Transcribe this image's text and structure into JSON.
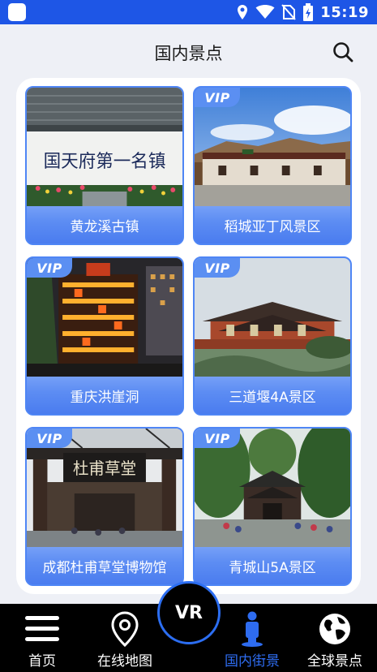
{
  "status_bar": {
    "time": "15:19"
  },
  "header": {
    "title": "国内景点"
  },
  "attractions": [
    {
      "name": "黄龙溪古镇",
      "vip": false
    },
    {
      "name": "稻城亚丁风景区",
      "vip": true
    },
    {
      "name": "重庆洪崖洞",
      "vip": true
    },
    {
      "name": "三道堰4A景区",
      "vip": true
    },
    {
      "name": "成都杜甫草堂博物馆",
      "vip": true
    },
    {
      "name": "青城山5A景区",
      "vip": true
    }
  ],
  "vip_label": "VIP",
  "photo_text": {
    "huanglongxi_sign": "国天府第一名镇",
    "dufu_plaque": "杜甫草堂"
  },
  "vr_button": {
    "label": "VR"
  },
  "nav": {
    "home": "首页",
    "online_map": "在线地图",
    "street_view": "国内街景",
    "global": "全球景点"
  },
  "colors": {
    "primary": "#1e56e6",
    "active_nav": "#2e6cf0",
    "card": "#4f86f5"
  }
}
